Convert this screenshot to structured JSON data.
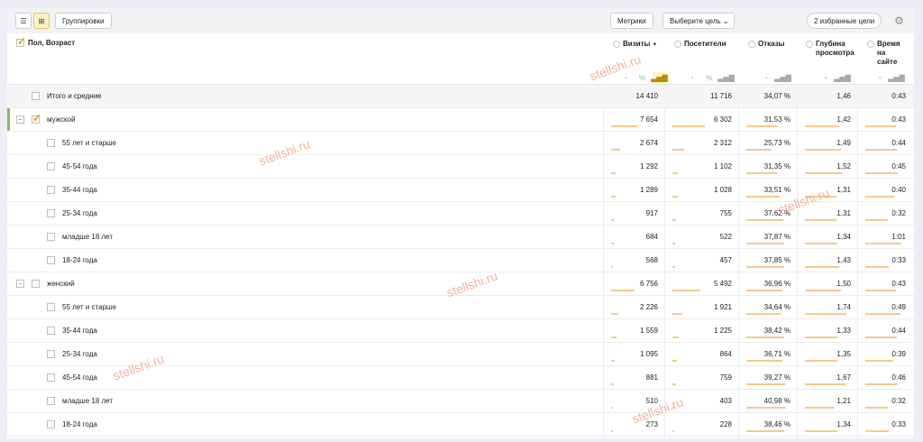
{
  "toolbar": {
    "groupings_label": "Группировки",
    "metrics_label": "Метрики",
    "goal_select_label": "Выберите цель",
    "favorites_label": "2 избранные цели"
  },
  "header": {
    "dimension_label": "Пол, Возраст",
    "columns": [
      {
        "title_line1": "Визиты",
        "title_line2": "",
        "sorted": true
      },
      {
        "title_line1": "Посетители",
        "title_line2": ""
      },
      {
        "title_line1": "Отказы",
        "title_line2": ""
      },
      {
        "title_line1": "Глубина",
        "title_line2": "просмотра"
      },
      {
        "title_line1": "Время",
        "title_line2": "на сайте"
      }
    ],
    "percent_glyph": "%",
    "sort_glyph": "▼"
  },
  "rows": [
    {
      "label": "Итого и средние",
      "level": 0,
      "total": true,
      "values": [
        "14 410",
        "11 716",
        "34,07 %",
        "1,46",
        "0:43"
      ]
    },
    {
      "label": "мужской",
      "level": 0,
      "group": true,
      "checked": true,
      "values": [
        "7 654",
        "6 302",
        "31,53 %",
        "1,42",
        "0:43"
      ],
      "bars": [
        0.53,
        0.54,
        0.93,
        0.97,
        1.0
      ]
    },
    {
      "label": "55 лет и старше",
      "level": 1,
      "values": [
        "2 674",
        "2 312",
        "25,73 %",
        "1,49",
        "0:44"
      ],
      "bars": [
        0.19,
        0.2,
        0.76,
        1.02,
        1.02
      ]
    },
    {
      "label": "45-54 года",
      "level": 1,
      "values": [
        "1 292",
        "1 102",
        "31,35 %",
        "1,52",
        "0:45"
      ],
      "bars": [
        0.09,
        0.09,
        0.92,
        1.04,
        1.05
      ]
    },
    {
      "label": "35-44 года",
      "level": 1,
      "values": [
        "1 289",
        "1 028",
        "33,51 %",
        "1,31",
        "0:40"
      ],
      "bars": [
        0.09,
        0.09,
        0.98,
        0.9,
        0.93
      ]
    },
    {
      "label": "25-34 года",
      "level": 1,
      "values": [
        "917",
        "755",
        "37,62 %",
        "1,31",
        "0:32"
      ],
      "bars": [
        0.06,
        0.06,
        1.1,
        0.9,
        0.74
      ]
    },
    {
      "label": "младше 18 лет",
      "level": 1,
      "values": [
        "684",
        "522",
        "37,87 %",
        "1,34",
        "1:01"
      ],
      "bars": [
        0.05,
        0.04,
        1.11,
        0.92,
        1.42
      ]
    },
    {
      "label": "18-24 года",
      "level": 1,
      "values": [
        "568",
        "457",
        "37,85 %",
        "1,43",
        "0:33"
      ],
      "bars": [
        0.04,
        0.04,
        1.11,
        0.98,
        0.77
      ]
    },
    {
      "label": "женский",
      "level": 0,
      "group": true,
      "checked": false,
      "values": [
        "6 756",
        "5 492",
        "36,96 %",
        "1,50",
        "0:43"
      ],
      "bars": [
        0.47,
        0.47,
        1.08,
        1.03,
        1.0
      ]
    },
    {
      "label": "55 лет и старше",
      "level": 1,
      "values": [
        "2 226",
        "1 921",
        "34,64 %",
        "1,74",
        "0:49"
      ],
      "bars": [
        0.15,
        0.16,
        1.02,
        1.19,
        1.14
      ]
    },
    {
      "label": "35-44 года",
      "level": 1,
      "values": [
        "1 559",
        "1 225",
        "38,42 %",
        "1,33",
        "0:44"
      ],
      "bars": [
        0.11,
        0.1,
        1.13,
        0.91,
        1.02
      ]
    },
    {
      "label": "25-34 года",
      "level": 1,
      "values": [
        "1 095",
        "864",
        "36,71 %",
        "1,35",
        "0:39"
      ],
      "bars": [
        0.08,
        0.07,
        1.08,
        0.92,
        0.91
      ]
    },
    {
      "label": "45-54 года",
      "level": 1,
      "values": [
        "881",
        "759",
        "39,27 %",
        "1,67",
        "0:46"
      ],
      "bars": [
        0.06,
        0.06,
        1.15,
        1.14,
        1.07
      ]
    },
    {
      "label": "младше 18 лет",
      "level": 1,
      "values": [
        "510",
        "403",
        "40,98 %",
        "1,21",
        "0:32"
      ],
      "bars": [
        0.04,
        0.03,
        1.2,
        0.83,
        0.74
      ]
    },
    {
      "label": "18-24 года",
      "level": 1,
      "values": [
        "273",
        "228",
        "38,46 %",
        "1,34",
        "0:33"
      ],
      "bars": [
        0.02,
        0.02,
        1.13,
        0.92,
        0.77
      ]
    }
  ],
  "watermark": "stellshi.ru",
  "colors": {
    "accent": "#fff1c2",
    "bar": "#f6c98c",
    "group_marker": "#7cc35a"
  }
}
